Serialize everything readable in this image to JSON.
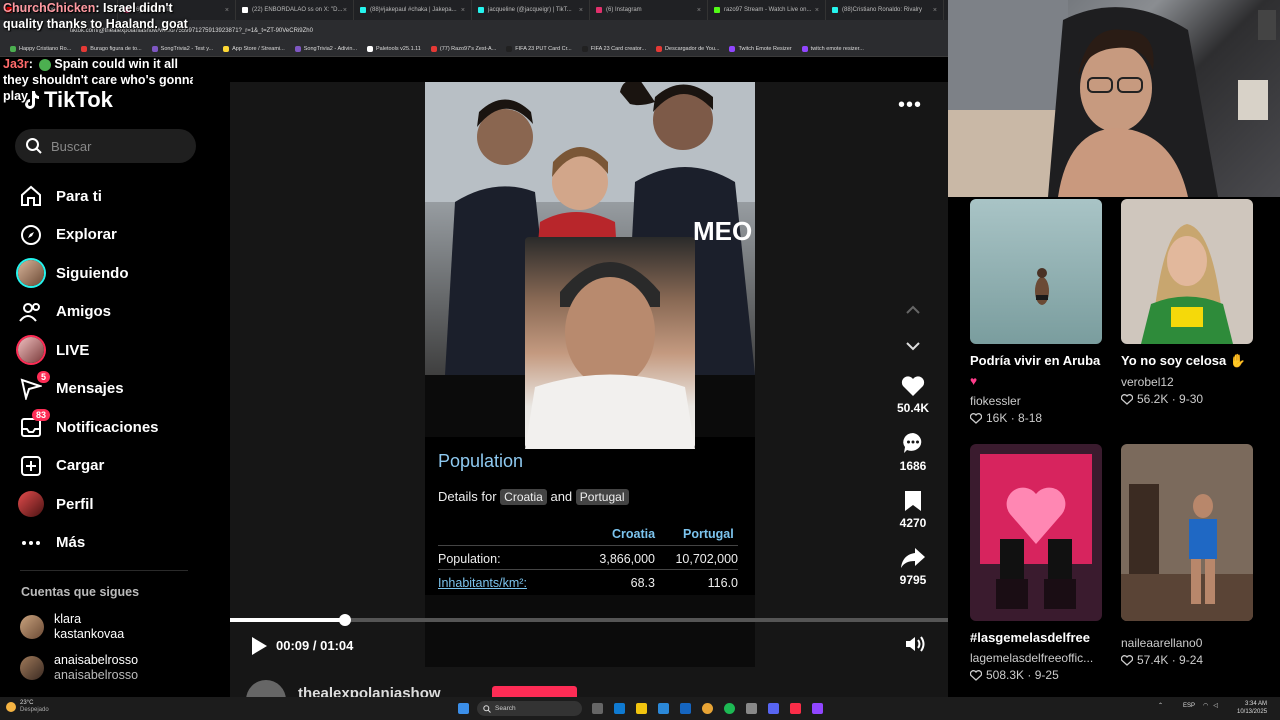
{
  "browser": {
    "tabs": [
      {
        "label": "(198) YouTube",
        "color": "#ff0000"
      },
      {
        "label": "(6) Instagram",
        "color": "#e1306c"
      },
      {
        "label": "(22) ENBORDALAO ss on X: \"D...",
        "color": "#ffffff"
      },
      {
        "label": "(88)#jakepaul #chaka | Jakepa...",
        "color": "#25f4ee"
      },
      {
        "label": "jacqueline (@jacqueigr) | TikT...",
        "color": "#25f4ee"
      },
      {
        "label": "(6) Instagram",
        "color": "#e1306c"
      },
      {
        "label": "razo97 Stream - Watch Live on...",
        "color": "#53fc18"
      },
      {
        "label": "(88)Cristiano Ronaldo: Rivalry",
        "color": "#25f4ee"
      }
    ],
    "url": "tiktok.com/@thealexpolaniashow/video/7559971275913923871?_r=1&_t=ZT-90VeCRi9Zh0",
    "bookmarks": [
      {
        "label": "Happy Cristiano Ro...",
        "color": "#4caf50"
      },
      {
        "label": "Burago figura de to...",
        "color": "#e53935"
      },
      {
        "label": "SongTrivia2 - Test y...",
        "color": "#7e57c2"
      },
      {
        "label": "App Store / Streami...",
        "color": "#fdd835"
      },
      {
        "label": "SongTrivia2 - Adivin...",
        "color": "#7e57c2"
      },
      {
        "label": "Paletools v25.1.11",
        "color": "#ffffff"
      },
      {
        "label": "(77) Razo97's Zest-A...",
        "color": "#e53935"
      },
      {
        "label": "FIFA 23 PUT Card Cr...",
        "color": "#212121"
      },
      {
        "label": "FIFA 23 Card creator...",
        "color": "#212121"
      },
      {
        "label": "Descargador de You...",
        "color": "#e53935"
      },
      {
        "label": "Twitch Emote Resizer",
        "color": "#9146ff"
      },
      {
        "label": "twitch emote resizer...",
        "color": "#9146ff"
      }
    ]
  },
  "chat": {
    "line1_user": "ChurchChicken",
    "line1_text": "Israel didn't",
    "line2": "quality thanks to Haaland. goat",
    "line3_user": "Ja3r",
    "line3_text": "Spain could win it all",
    "line4": "they shouldn't care who's gonna",
    "line5": "play"
  },
  "sidebar": {
    "logo": "TikTok",
    "search_placeholder": "Buscar",
    "nav": [
      {
        "label": "Para ti",
        "icon": "home-icon"
      },
      {
        "label": "Explorar",
        "icon": "compass-icon"
      },
      {
        "label": "Siguiendo",
        "icon": "avatar"
      },
      {
        "label": "Amigos",
        "icon": "friends-icon"
      },
      {
        "label": "LIVE",
        "icon": "avatar"
      },
      {
        "label": "Mensajes",
        "icon": "send-icon",
        "badge": "5"
      },
      {
        "label": "Notificaciones",
        "icon": "inbox-icon",
        "badge": "83"
      },
      {
        "label": "Cargar",
        "icon": "plus-square-icon"
      },
      {
        "label": "Perfil",
        "icon": "avatar"
      },
      {
        "label": "Más",
        "icon": "more-icon"
      }
    ],
    "following_title": "Cuentas que sigues",
    "accounts": [
      {
        "name": "klara",
        "handle": "kastankovaa"
      },
      {
        "name": "anaisabelrosso",
        "handle": "anaisabelrosso"
      }
    ]
  },
  "video": {
    "card_title": "Population",
    "details_prefix": "Details for",
    "country_a": "Croatia",
    "and": "and",
    "country_b": "Portugal",
    "table": {
      "col_a": "Croatia",
      "col_b": "Portugal",
      "rows": [
        {
          "label": "Population:",
          "a": "3,866,000",
          "b": "10,702,000"
        },
        {
          "label": "Inhabitants/km²:",
          "a": "68.3",
          "b": "116.0"
        }
      ]
    },
    "jersey_text": "MEO",
    "likes": "50.4K",
    "comments": "1686",
    "saves": "4270",
    "shares": "9795",
    "time_current": "00:09",
    "time_total": "01:04",
    "time_separator": "/",
    "progress": 0.16,
    "author": "thealexpolaniashow"
  },
  "feed": [
    {
      "title": "Podría vivir en Aruba",
      "emoji": "♥",
      "user": "fiokessler",
      "likes": "16K",
      "date": "8-18"
    },
    {
      "title": "Yo no soy celosa ✋",
      "user": "verobel12",
      "likes": "56.2K",
      "date": "9-30"
    },
    {
      "title": "#lasgemelasdelfree",
      "user": "lagemelasdelfreeoffic...",
      "likes": "508.3K",
      "date": "9-25"
    },
    {
      "title": "",
      "user": "naileaarellano0",
      "likes": "57.4K",
      "date": "9-24"
    }
  ],
  "taskbar": {
    "weather_temp": "23°C",
    "weather_desc": "Despejado",
    "search": "Search",
    "lang": "ESP",
    "time": "3:34 AM",
    "date": "10/13/2025"
  }
}
